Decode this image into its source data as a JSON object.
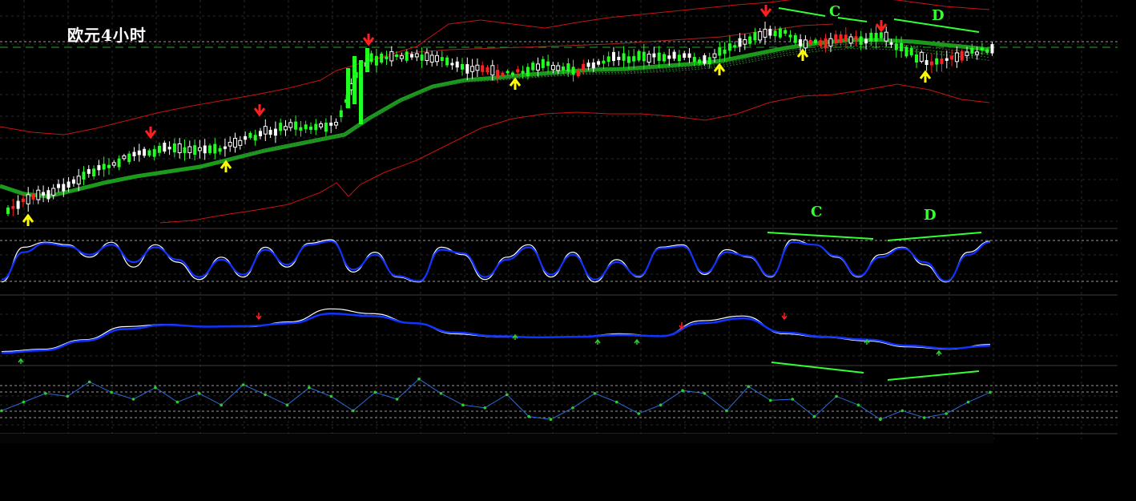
{
  "title": "欧元4小时",
  "colors": {
    "bull_candle": "#22ff22",
    "bear_candle": "#ffffff",
    "red_candle": "#ff2020",
    "bands": "#cc1111",
    "ma_thick": "#1c9a1c",
    "fast_line": "#ffffff",
    "slow_line": "#1133ff",
    "rsi_line": "#2d6bd6",
    "rsi_dots": "#28d028",
    "down_arrow": "#ff1f1f",
    "up_arrow": "#ffff00",
    "divergence": "#33ff33"
  },
  "annotations": {
    "price_wave_c": "C",
    "price_wave_d": "D",
    "osc_wave_c": "C",
    "osc_wave_d": "D"
  },
  "chart_data": [
    {
      "type": "line",
      "panel": "price",
      "series": [
        {
          "values": [
            3.2,
            3.6,
            4.4,
            4.5,
            4.6,
            5.3,
            5.9,
            6.2,
            6.4,
            6.8,
            6.7,
            6.6,
            6.6,
            6.9,
            7.1,
            7.0,
            6.9,
            7.6,
            8.3,
            8.4,
            8.5,
            8.1,
            7.8,
            7.8,
            7.6,
            7.4,
            7.3,
            7.2,
            7.5,
            7.5,
            7.4,
            7.2,
            7.1,
            7.2,
            7.4,
            7.0,
            6.9,
            7.3,
            7.3,
            7.4,
            7.7,
            7.9,
            8.0,
            8.1,
            8.0,
            8.2,
            8.4,
            8.5,
            8.5,
            8.7,
            8.7,
            8.8,
            8.7,
            8.6,
            8.9
          ]
        },
        {
          "values": [
            4.0,
            4.2,
            4.6,
            4.9,
            5.1,
            5.6,
            6.1,
            6.2,
            6.5,
            6.9,
            7.0,
            6.9,
            6.9,
            7.1,
            7.3,
            7.2,
            7.2,
            7.7,
            8.1,
            8.3,
            8.3,
            8.2,
            8.1,
            8.0,
            7.9,
            7.7,
            7.6,
            7.4,
            7.5,
            7.5,
            7.4,
            7.3,
            7.3,
            7.3,
            7.4,
            7.3,
            7.3,
            7.4,
            7.4,
            7.6,
            7.8,
            8.0,
            8.1,
            8.1,
            8.1,
            8.2,
            8.3,
            8.4,
            8.5,
            8.5,
            8.6,
            8.7,
            8.7,
            8.7,
            8.8
          ]
        }
      ]
    },
    {
      "type": "line",
      "panel": "stochastic",
      "series": [
        {
          "values": [
            10,
            80,
            90,
            85,
            60,
            90,
            40,
            85,
            50,
            15,
            60,
            20,
            80,
            40,
            88,
            95,
            30,
            70,
            20,
            10,
            80,
            65,
            15,
            60,
            85,
            20,
            70,
            10,
            55,
            20,
            80,
            85,
            25,
            75,
            60,
            20,
            95,
            85,
            60,
            20,
            65,
            80,
            45,
            10,
            70,
            92
          ]
        },
        {
          "values": [
            15,
            70,
            88,
            82,
            65,
            85,
            50,
            80,
            55,
            20,
            55,
            25,
            75,
            45,
            85,
            92,
            35,
            65,
            22,
            12,
            75,
            68,
            20,
            55,
            80,
            25,
            65,
            15,
            50,
            22,
            78,
            82,
            28,
            70,
            62,
            22,
            90,
            85,
            62,
            22,
            60,
            78,
            50,
            12,
            65,
            90
          ]
        }
      ]
    },
    {
      "type": "line",
      "panel": "smooth_oscillator",
      "series": [
        {
          "values": [
            10,
            14,
            30,
            52,
            56,
            52,
            52,
            60,
            82,
            74,
            58,
            40,
            35,
            34,
            35,
            40,
            36,
            62,
            70,
            40,
            34,
            28,
            18,
            14,
            22
          ]
        },
        {
          "values": [
            8,
            12,
            28,
            48,
            55,
            52,
            53,
            58,
            74,
            70,
            58,
            42,
            36,
            34,
            35,
            38,
            36,
            58,
            66,
            42,
            35,
            30,
            20,
            15,
            20
          ]
        }
      ]
    },
    {
      "type": "line",
      "panel": "rsi",
      "series": [
        {
          "values": [
            30,
            45,
            60,
            55,
            80,
            62,
            50,
            70,
            45,
            60,
            40,
            75,
            58,
            40,
            70,
            55,
            30,
            62,
            50,
            85,
            60,
            40,
            35,
            58,
            20,
            15,
            35,
            60,
            45,
            25,
            40,
            65,
            60,
            30,
            72,
            48,
            50,
            20,
            55,
            40,
            15,
            30,
            18,
            25,
            45,
            62
          ]
        }
      ]
    }
  ]
}
